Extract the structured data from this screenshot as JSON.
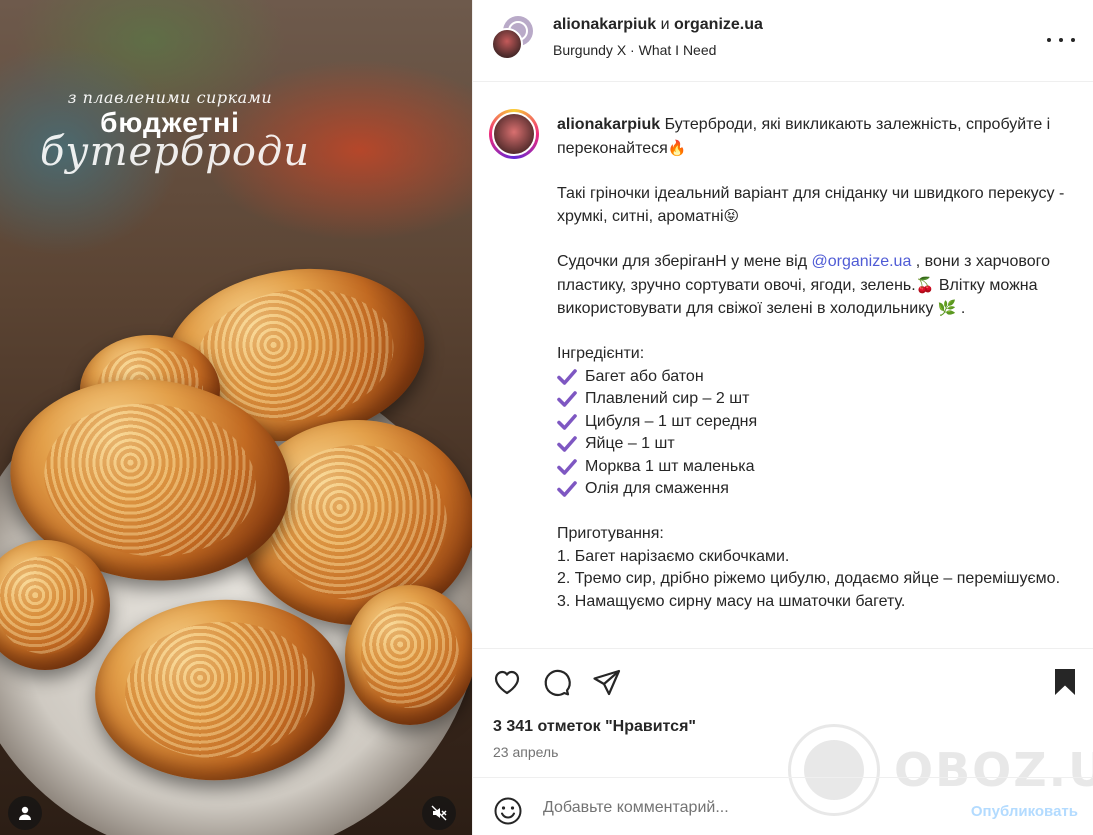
{
  "photo": {
    "caption_line1": "з плавленими сирками",
    "caption_line2": "бюджетні",
    "caption_line3": "бутерброди",
    "profile_icon": "user-icon",
    "mute_icon": "volume-off-icon"
  },
  "header": {
    "author1": "alionakarpiuk",
    "connector": "и",
    "author2": "organize.ua",
    "audio": "Burgundy X · What I Need",
    "more_icon": "more-horizontal-icon"
  },
  "caption": {
    "username": "alionakarpiuk",
    "intro": "Бутерброди, які викликають залежність, спробуйте і переконайтеся",
    "intro_emoji": "🔥",
    "para2": "Такі гріночки ідеальний варіант для сніданку чи швидкого перекусу - хрумкі, ситні, ароматні",
    "para2_emoji": "😝",
    "para3_before": "Судочки для зберіганН у мене від ",
    "para3_mention": "@organize.ua",
    "para3_after": " , вони з харчового пластику, зручно сортувати овочі, ягоди, зелень.",
    "para3_emoji": "🍒",
    "para4": "Влітку можна використовувати для свіжої зелені в холодильнику",
    "para4_emoji": "🌿",
    "para4_end": " .",
    "ingredients_title": "Інгредієнти:",
    "ingredients": [
      "Багет або батон",
      "Плавлений сир – 2 шт",
      "Цибуля – 1 шт середня",
      "Яйце – 1 шт",
      "Морква 1 шт маленька",
      "Олія для смаження"
    ],
    "steps_title": "Приготування:",
    "steps": [
      "1. Багет нарізаємо скибочками.",
      "2. Тремо сир, дрібно ріжемо цибулю, додаємо яйце – перемішуємо.",
      "3. Намащуємо сирну масу на шматочки багету."
    ]
  },
  "actions": {
    "like_icon": "heart-icon",
    "comment_icon": "comment-icon",
    "share_icon": "send-icon",
    "save_icon": "bookmark-icon"
  },
  "likes": "3 341 отметок \"Нравится\"",
  "date": "23 апрель",
  "comment": {
    "placeholder": "Добавьте комментарий...",
    "publish_label": "Опубликовать",
    "emoji_icon": "smiley-icon"
  },
  "watermark": "OBOZ.UA",
  "colors": {
    "mention": "#4f5bd5",
    "check": "#7e57c2",
    "publish_disabled": "#b3dbff",
    "text": "#262626",
    "secondary": "#737373"
  }
}
